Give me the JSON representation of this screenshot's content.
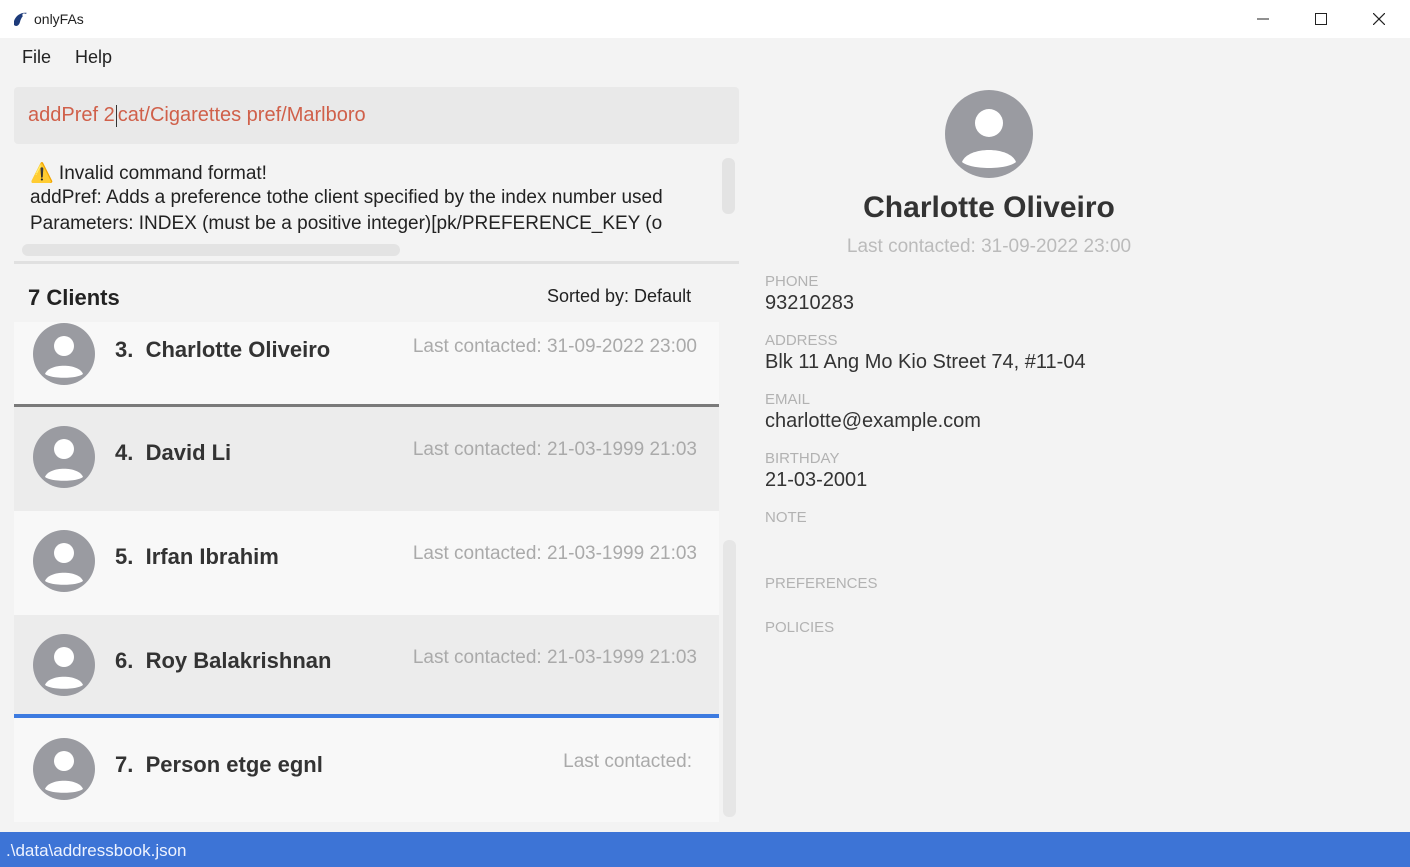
{
  "window": {
    "title": "onlyFAs"
  },
  "menu": {
    "file": "File",
    "help": "Help"
  },
  "command": {
    "before_caret": "addPref 2",
    "after_caret": "cat/Cigarettes pref/Marlboro"
  },
  "result": {
    "line1": "⚠️ Invalid command format!",
    "line2": "addPref: Adds a preference tothe client specified by the index number used",
    "line3": "Parameters: INDEX (must be a positive integer)[pk/PREFERENCE_KEY (o"
  },
  "list": {
    "title": "7 Clients",
    "sort": "Sorted by: Default",
    "clients": [
      {
        "index": "3.",
        "name": "Charlotte Oliveiro",
        "contact": "Last contacted: 31-09-2022 23:00"
      },
      {
        "index": "4.",
        "name": "David Li",
        "contact": "Last contacted: 21-03-1999 21:03"
      },
      {
        "index": "5.",
        "name": "Irfan Ibrahim",
        "contact": "Last contacted: 21-03-1999 21:03"
      },
      {
        "index": "6.",
        "name": "Roy Balakrishnan",
        "contact": "Last contacted: 21-03-1999 21:03"
      },
      {
        "index": "7.",
        "name": "Person etge egnl",
        "contact": "Last contacted:"
      }
    ]
  },
  "detail": {
    "name": "Charlotte Oliveiro",
    "contact": "Last contacted: 31-09-2022 23:00",
    "phone_label": "PHONE",
    "phone": "93210283",
    "address_label": "ADDRESS",
    "address": "Blk 11 Ang Mo Kio Street 74, #11-04",
    "email_label": "EMAIL",
    "email": "charlotte@example.com",
    "birthday_label": "BIRTHDAY",
    "birthday": "21-03-2001",
    "note_label": "NOTE",
    "preferences_label": "PREFERENCES",
    "policies_label": "POLICIES"
  },
  "status": {
    "path": ".\\data\\addressbook.json"
  },
  "colors": {
    "accent": "#3d74d6",
    "command_text": "#d0604a",
    "selected_border": "#3d7be0"
  }
}
